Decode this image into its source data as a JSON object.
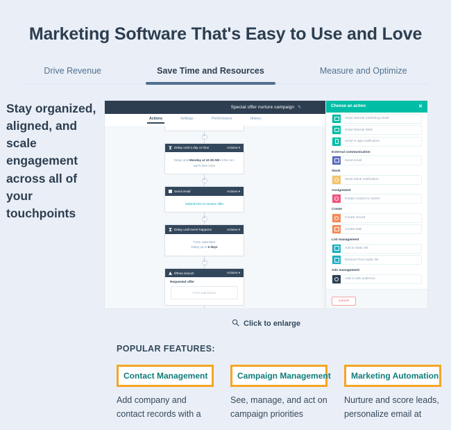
{
  "header": {
    "title": "Marketing Software That's Easy to Use and Love"
  },
  "tabs": [
    {
      "label": "Drive Revenue",
      "active": false
    },
    {
      "label": "Save Time and Resources",
      "active": true
    },
    {
      "label": "Measure and Optimize",
      "active": false
    }
  ],
  "left_copy": {
    "text": "Stay organized, aligned, and scale engagement across all of your touchpoints"
  },
  "screenshot": {
    "workflow": {
      "title": "Special offer nurture campaign",
      "edit_icon": "pencil-icon",
      "tabs": [
        {
          "label": "Actions",
          "active": true
        },
        {
          "label": "Settings",
          "active": false
        },
        {
          "label": "Performance",
          "active": false
        },
        {
          "label": "History",
          "active": false
        }
      ],
      "steps": [
        {
          "icon": "hourglass-icon",
          "title": "Delay until a day or time",
          "actions_label": "Actions",
          "body_line1_pre": "Delay until ",
          "body_line1_bold": "Monday at 10:30 AM",
          "body_line1_post": " in the con-",
          "body_line2": "tact's time zone"
        },
        {
          "icon": "envelope-icon",
          "title": "Send email",
          "actions_label": "Actions",
          "link": "Submit form to receive offer"
        },
        {
          "icon": "hourglass-icon",
          "title": "Delay until event happens",
          "actions_label": "Actions",
          "body_line1": "Form submitted",
          "body_line2_pre": "Delay up to ",
          "body_line2_bold": "5 days"
        },
        {
          "icon": "branch-icon",
          "title": "If/then branch",
          "actions_label": "Actions",
          "sub_label": "Requested offer",
          "sub_box": "Form submission"
        }
      ],
      "plus_label": "+"
    },
    "action_panel": {
      "title": "Choose an action",
      "close_icon": "close-icon",
      "groups": [
        {
          "label": "",
          "items": [
            {
              "label": "Send internal marketing email",
              "icon": "envelope-icon",
              "color": "#00bda5"
            },
            {
              "label": "Send internal SMS",
              "icon": "chat-icon",
              "color": "#00bda5"
            },
            {
              "label": "Send in-app notification",
              "icon": "bell-icon",
              "color": "#00bda5"
            }
          ]
        },
        {
          "label": "External communication",
          "items": [
            {
              "label": "Send email",
              "icon": "envelope-icon",
              "color": "#5c6bc0"
            }
          ]
        },
        {
          "label": "Slack",
          "items": [
            {
              "label": "Send Slack notification",
              "icon": "slack-icon",
              "color": "#f5c26b"
            }
          ]
        },
        {
          "label": "Assignment",
          "items": [
            {
              "label": "Rotate contact to owner",
              "icon": "person-icon",
              "color": "#f2547d"
            }
          ]
        },
        {
          "label": "Create",
          "items": [
            {
              "label": "Create record",
              "icon": "record-icon",
              "color": "#f58b5a"
            },
            {
              "label": "Create task",
              "icon": "task-icon",
              "color": "#f58b5a"
            }
          ]
        },
        {
          "label": "List management",
          "items": [
            {
              "label": "Add to static list",
              "icon": "list-add-icon",
              "color": "#1cb0c4"
            },
            {
              "label": "Remove from static list",
              "icon": "list-remove-icon",
              "color": "#1cb0c4"
            }
          ]
        },
        {
          "label": "Ads management",
          "items": [
            {
              "label": "Add to ads audience",
              "icon": "ads-icon",
              "color": "#2e3f52"
            }
          ]
        }
      ],
      "cancel_label": "Cancel"
    }
  },
  "enlarge": {
    "label": "Click to enlarge",
    "icon": "magnifier-icon"
  },
  "features": {
    "title": "POPULAR FEATURES:",
    "items": [
      {
        "name": "Contact Management",
        "desc": "Add company and contact records with a"
      },
      {
        "name": "Campaign Management",
        "desc": "See, manage, and act on campaign priorities"
      },
      {
        "name": "Marketing Automation",
        "desc": "Nurture and score leads, personalize email at"
      }
    ]
  },
  "colors": {
    "page_background": "#eaeff7",
    "heading": "#2d3e50",
    "tab_active_underline": "#516f90",
    "feature_border": "#f5a623",
    "feature_text": "#0f7c7b",
    "panel_header": "#00bda5",
    "workflow_header": "#2d3e50"
  }
}
